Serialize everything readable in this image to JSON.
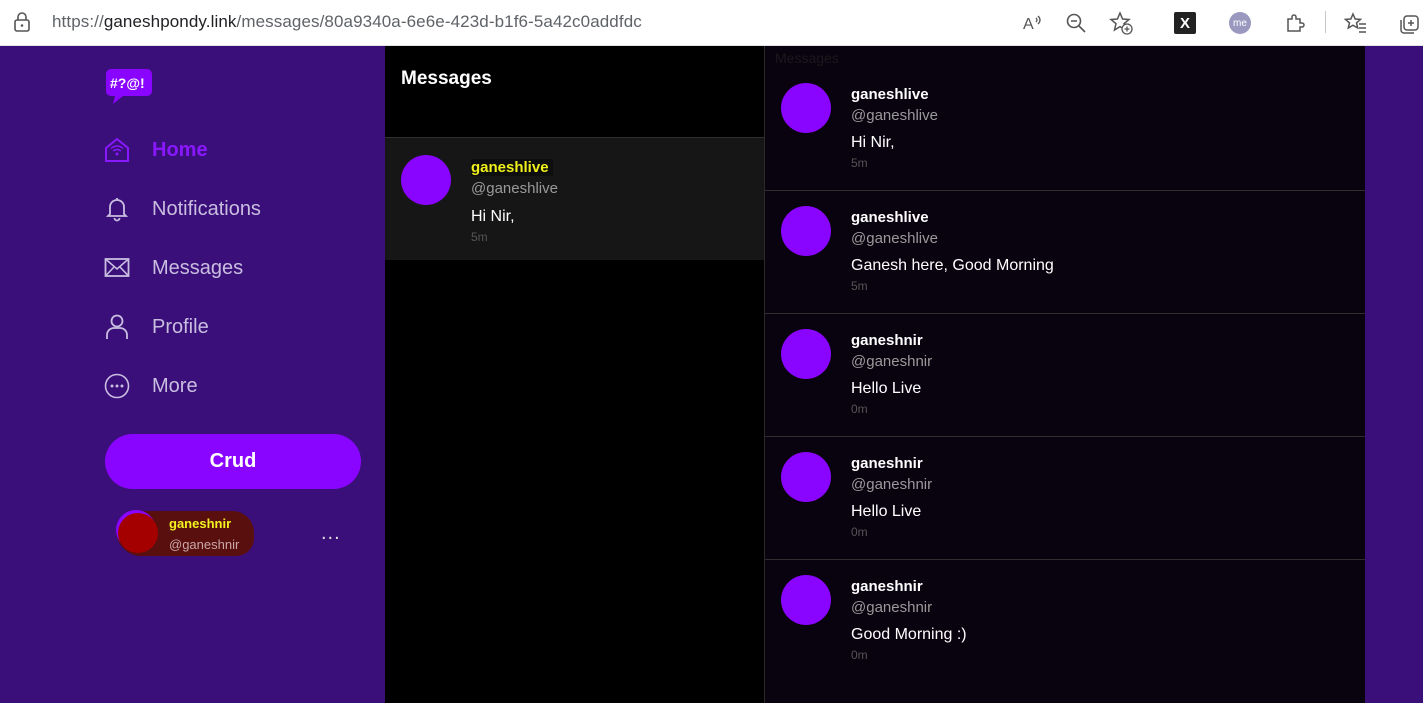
{
  "browser": {
    "url_prefix": "https://",
    "url_host": "ganeshpondy.link",
    "url_path": "/messages/80a9340a-6e6e-423d-b1f6-5a42c0addfdc",
    "ext_x": "X",
    "ext_me": "me"
  },
  "sidebar": {
    "logo_text": "#?@!",
    "nav": [
      {
        "label": "Home",
        "icon": "home-icon"
      },
      {
        "label": "Notifications",
        "icon": "bell-icon"
      },
      {
        "label": "Messages",
        "icon": "mail-icon"
      },
      {
        "label": "Profile",
        "icon": "user-icon"
      },
      {
        "label": "More",
        "icon": "more-circle-icon"
      }
    ],
    "crud_label": "Crud",
    "user": {
      "name": "ganeshnir",
      "handle": "@ganeshnir",
      "more": "..."
    }
  },
  "messages": {
    "title": "Messages",
    "conversations": [
      {
        "name": "ganeshlive",
        "handle": "@ganeshlive",
        "text": "Hi Nir,",
        "time": "5m"
      }
    ]
  },
  "thread": {
    "header": "Messages",
    "items": [
      {
        "name": "ganeshlive",
        "handle": "@ganeshlive",
        "text": "Hi Nir,",
        "time": "5m"
      },
      {
        "name": "ganeshlive",
        "handle": "@ganeshlive",
        "text": "Ganesh here, Good Morning",
        "time": "5m"
      },
      {
        "name": "ganeshnir",
        "handle": "@ganeshnir",
        "text": "Hello Live",
        "time": "0m"
      },
      {
        "name": "ganeshnir",
        "handle": "@ganeshnir",
        "text": "Hello Live",
        "time": "0m"
      },
      {
        "name": "ganeshnir",
        "handle": "@ganeshnir",
        "text": "Good Morning :)",
        "time": "0m"
      }
    ]
  },
  "colors": {
    "sidebar_bg": "#3a0f7a",
    "accent": "#8a05ff",
    "highlight_name": "#f0f01a"
  }
}
